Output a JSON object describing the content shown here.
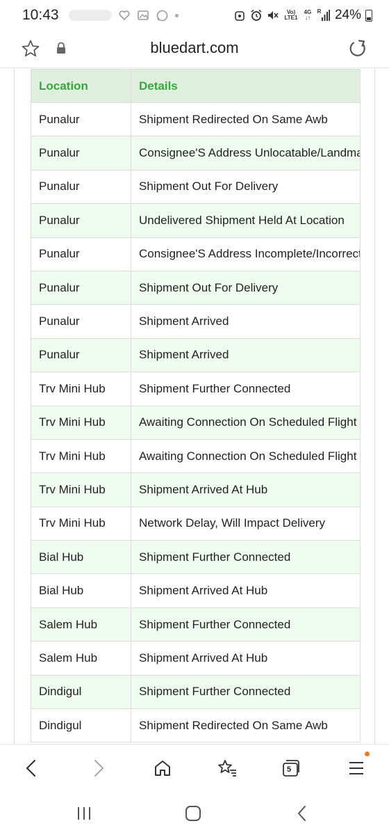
{
  "status_bar": {
    "time": "10:43",
    "volte": "Vo)",
    "lte": "LTE1",
    "network": "4G",
    "roaming": "R",
    "battery": "24%"
  },
  "url_bar": {
    "domain": "bluedart.com"
  },
  "table": {
    "headers": [
      "Location",
      "Details"
    ],
    "rows": [
      [
        "Punalur",
        "Shipment Redirected On Same Awb"
      ],
      [
        "Punalur",
        "Consignee'S Address Unlocatable/Landmark"
      ],
      [
        "Punalur",
        "Shipment Out For Delivery"
      ],
      [
        "Punalur",
        "Undelivered Shipment Held At Location"
      ],
      [
        "Punalur",
        "Consignee'S Address Incomplete/Incorrect"
      ],
      [
        "Punalur",
        "Shipment Out For Delivery"
      ],
      [
        "Punalur",
        "Shipment Arrived"
      ],
      [
        "Punalur",
        "Shipment Arrived"
      ],
      [
        "Trv Mini Hub",
        "Shipment Further Connected"
      ],
      [
        "Trv Mini Hub",
        "Awaiting Connection On Scheduled Flight"
      ],
      [
        "Trv Mini Hub",
        "Awaiting Connection On Scheduled Flight"
      ],
      [
        "Trv Mini Hub",
        "Shipment Arrived At Hub"
      ],
      [
        "Trv Mini Hub",
        "Network Delay, Will Impact Delivery"
      ],
      [
        "Bial Hub",
        "Shipment Further Connected"
      ],
      [
        "Bial Hub",
        "Shipment Arrived At Hub"
      ],
      [
        "Salem Hub",
        "Shipment Further Connected"
      ],
      [
        "Salem Hub",
        "Shipment Arrived At Hub"
      ],
      [
        "Dindigul",
        "Shipment Further Connected"
      ],
      [
        "Dindigul",
        "Shipment Redirected On Same Awb"
      ]
    ]
  },
  "browser_bar": {
    "tab_count": "5"
  },
  "colors": {
    "header_bg": "#def0dd",
    "header_text": "#3aa640",
    "alt_row_bg": "#f0fbf0",
    "notification_dot": "#f47b20"
  },
  "icons": [
    "star-icon",
    "lock-icon",
    "reload-icon",
    "back-icon",
    "forward-icon",
    "home-icon",
    "bookmarks-icon",
    "tabs-icon",
    "menu-icon",
    "recent-apps-icon",
    "home-nav-icon",
    "back-nav-icon"
  ]
}
